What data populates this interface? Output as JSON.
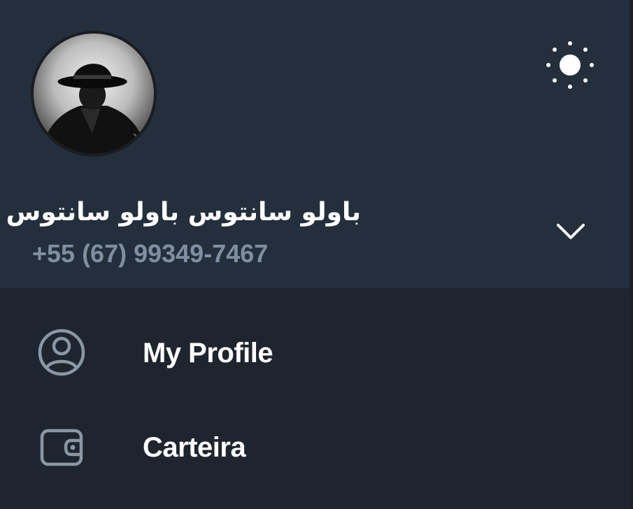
{
  "header": {
    "user_name": "باولو سانتوس باولو سانتوس",
    "phone": "+55 (67) 99349-7467",
    "theme_icon": "sun-icon",
    "expand_icon": "chevron-down-icon",
    "avatar_desc": "avatar"
  },
  "menu": {
    "items": [
      {
        "label": "My Profile",
        "icon": "profile-icon"
      },
      {
        "label": "Carteira",
        "icon": "wallet-icon"
      }
    ]
  },
  "colors": {
    "header_bg": "#242f3d",
    "menu_bg": "#1f252f",
    "text_primary": "#ffffff",
    "text_secondary": "#7f8fa1",
    "icon_color": "#8a97a5"
  }
}
